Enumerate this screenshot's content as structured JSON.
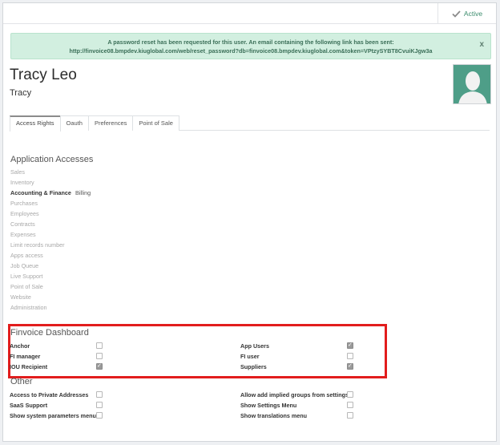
{
  "status": {
    "label": "Active"
  },
  "alert": {
    "line1": "A password reset has been requested for this user. An email containing the following link has been sent:",
    "line2": "http://finvoice08.bmpdev.kiuglobal.com/web/reset_password?db=finvoice08.bmpdev.kiuglobal.com&token=VPtzySYBT8CvuiKJgw3a",
    "close": "x"
  },
  "user": {
    "name": "Tracy Leo",
    "login": "Tracy"
  },
  "tabs": [
    {
      "label": "Access Rights"
    },
    {
      "label": "Oauth"
    },
    {
      "label": "Preferences"
    },
    {
      "label": "Point of Sale"
    }
  ],
  "app_section": {
    "title": "Application Accesses",
    "items": [
      {
        "label": "Sales",
        "value": ""
      },
      {
        "label": "Inventory",
        "value": ""
      },
      {
        "label": "Accounting & Finance",
        "value": "Billing"
      },
      {
        "label": "Purchases",
        "value": ""
      },
      {
        "label": "Employees",
        "value": ""
      },
      {
        "label": "Contracts",
        "value": ""
      },
      {
        "label": "Expenses",
        "value": ""
      },
      {
        "label": "Limit records number",
        "value": ""
      },
      {
        "label": "Apps access",
        "value": ""
      },
      {
        "label": "Job Queue",
        "value": ""
      },
      {
        "label": "Live Support",
        "value": ""
      },
      {
        "label": "Point of Sale",
        "value": ""
      },
      {
        "label": "Website",
        "value": ""
      },
      {
        "label": "Administration",
        "value": ""
      }
    ]
  },
  "finvoice": {
    "title": "Finvoice Dashboard",
    "left": [
      {
        "label": "Anchor",
        "checked": false
      },
      {
        "label": "FI manager",
        "checked": false
      },
      {
        "label": "IOU Recipient",
        "checked": true
      }
    ],
    "right": [
      {
        "label": "App Users",
        "checked": true
      },
      {
        "label": "FI user",
        "checked": false
      },
      {
        "label": "Suppliers",
        "checked": true
      }
    ]
  },
  "other": {
    "title": "Other",
    "left": [
      {
        "label": "Access to Private Addresses",
        "checked": false
      },
      {
        "label": "SaaS Support",
        "checked": false
      },
      {
        "label": "Show system parameters menu",
        "checked": false
      }
    ],
    "right": [
      {
        "label": "Allow add implied groups from settings",
        "checked": false
      },
      {
        "label": "Show Settings Menu",
        "checked": false
      },
      {
        "label": "Show translations menu",
        "checked": false
      }
    ]
  }
}
